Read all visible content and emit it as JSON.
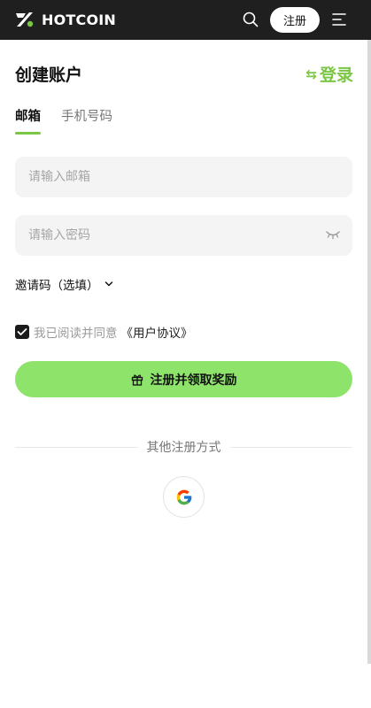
{
  "header": {
    "brand": "HOTCOIN",
    "register_label": "注册",
    "icons": {
      "logo": "hotcoin-logo-icon",
      "search": "search-icon",
      "menu": "menu-icon"
    }
  },
  "page": {
    "title": "创建账户",
    "login_label": "登录",
    "login_icon": "swap-arrows-icon"
  },
  "tabs": [
    {
      "label": "邮箱",
      "active": true
    },
    {
      "label": "手机号码",
      "active": false
    }
  ],
  "form": {
    "email_placeholder": "请输入邮箱",
    "password_placeholder": "请输入密码",
    "invite_label": "邀请码（选填）",
    "agree_text": "我已阅读并同意",
    "agree_link": "《用户协议》",
    "agree_checked": true,
    "submit_label": "注册并领取奖励"
  },
  "alt_signup": {
    "label": "其他注册方式",
    "providers": [
      "google-icon"
    ]
  },
  "colors": {
    "accent": "#7bc745",
    "button": "#8ee36a",
    "header_bg": "#1f1f1f"
  }
}
